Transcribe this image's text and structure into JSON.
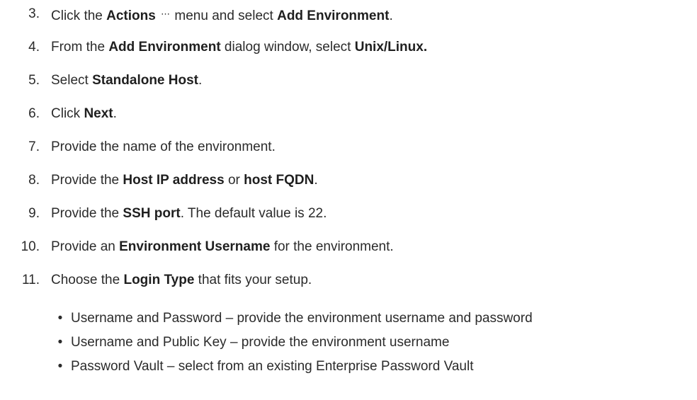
{
  "steps": [
    {
      "number": "3.",
      "parts": [
        "Click the ",
        "Actions",
        " menu and select ",
        "Add Environment",
        "."
      ],
      "icon": "ellipsis-icon"
    },
    {
      "number": "4.",
      "parts": [
        "From the ",
        "Add Environment",
        " dialog window, select ",
        "Unix/Linux."
      ]
    },
    {
      "number": "5.",
      "parts": [
        "Select ",
        "Standalone Host",
        "."
      ]
    },
    {
      "number": "6.",
      "parts": [
        "Click ",
        "Next",
        "."
      ]
    },
    {
      "number": "7.",
      "parts": [
        "Provide the name of the environment."
      ]
    },
    {
      "number": "8.",
      "parts": [
        "Provide the ",
        "Host IP address",
        " or ",
        "host FQDN",
        "."
      ]
    },
    {
      "number": "9.",
      "parts": [
        "Provide the ",
        "SSH port",
        ". The default value is 22."
      ]
    },
    {
      "number": "10.",
      "parts": [
        "Provide an ",
        "Environment Username",
        " for the environment."
      ]
    },
    {
      "number": "11.",
      "parts": [
        "Choose the ",
        "Login Type",
        " that fits your setup."
      ]
    }
  ],
  "ellipsis_glyph": "⋯",
  "bullet_glyph": "•",
  "login_options": [
    "Username and Password – provide the environment username and password",
    "Username and Public Key – provide the environment username",
    "Password Vault – select from an existing Enterprise Password Vault"
  ]
}
